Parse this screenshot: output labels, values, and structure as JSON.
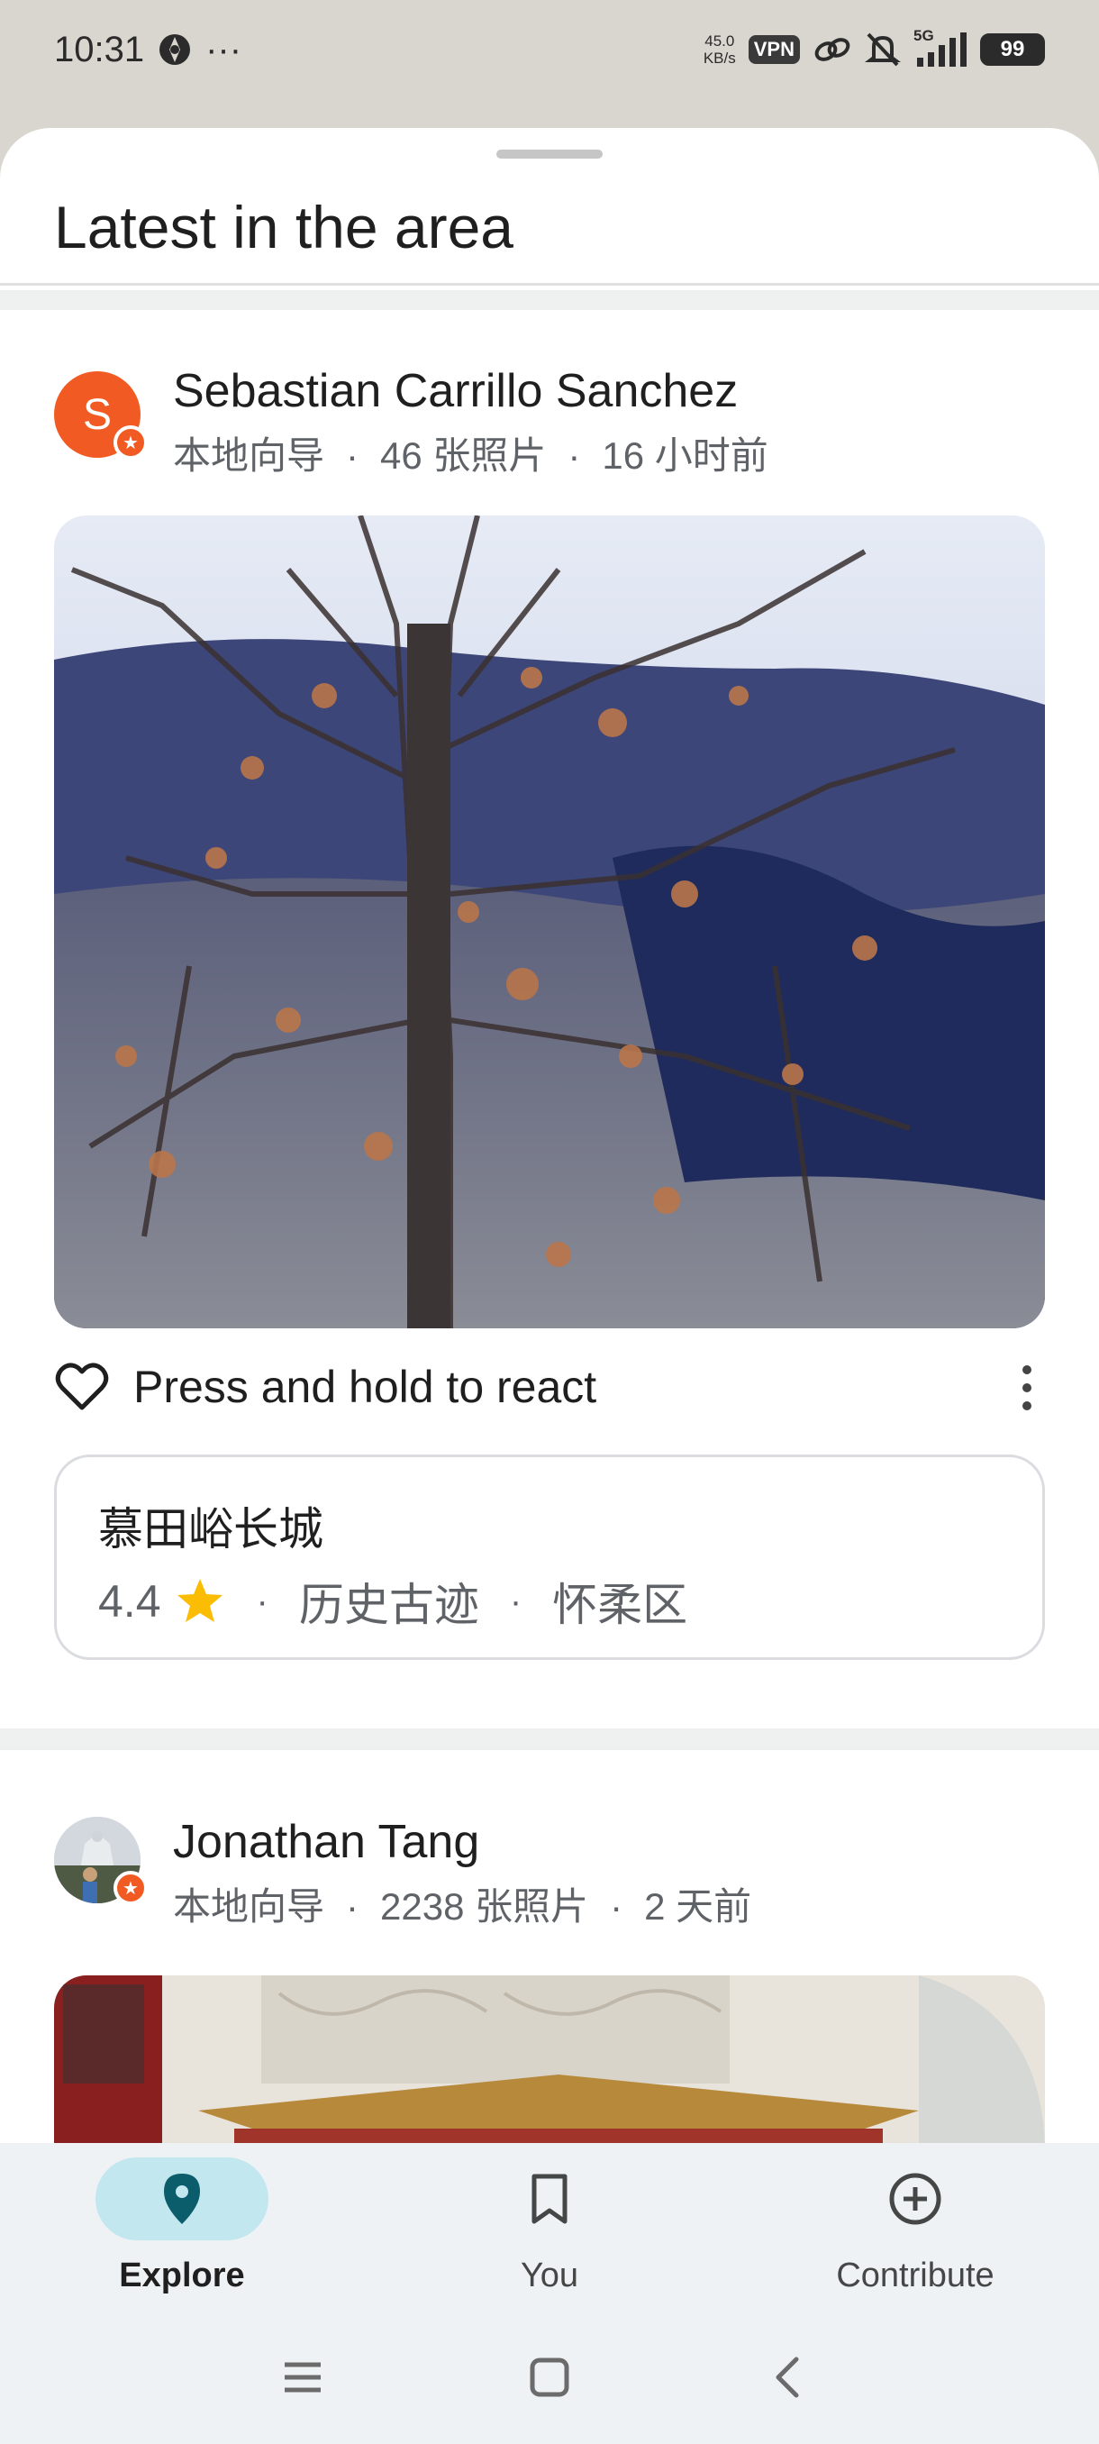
{
  "status_bar": {
    "time": "10:31",
    "extra": "···",
    "net_speed_value": "45.0",
    "net_speed_unit": "KB/s",
    "vpn_label": "VPN",
    "signal_label": "5G",
    "battery": "99"
  },
  "sheet": {
    "title": "Latest in the area"
  },
  "posts": [
    {
      "avatar_letter": "S",
      "author": "Sebastian Carrillo Sanchez",
      "role": "本地向导",
      "photos": "46 张照片",
      "time_ago": "16 小时前",
      "react_label": "Press and hold to react",
      "place": {
        "name": "慕田峪长城",
        "rating": "4.4",
        "category": "历史古迹",
        "district": "怀柔区"
      }
    },
    {
      "author": "Jonathan Tang",
      "role": "本地向导",
      "photos": "2238 张照片",
      "time_ago": "2 天前"
    }
  ],
  "bottom_nav": {
    "items": [
      {
        "label": "Explore",
        "icon": "location-pin-icon",
        "active": true
      },
      {
        "label": "You",
        "icon": "bookmark-icon",
        "active": false
      },
      {
        "label": "Contribute",
        "icon": "add-circle-icon",
        "active": false
      }
    ]
  },
  "colors": {
    "accent_orange": "#f15a22",
    "active_pill": "#c2e7ef",
    "pin_teal": "#0b5d6b",
    "star_yellow": "#fbbc04"
  }
}
